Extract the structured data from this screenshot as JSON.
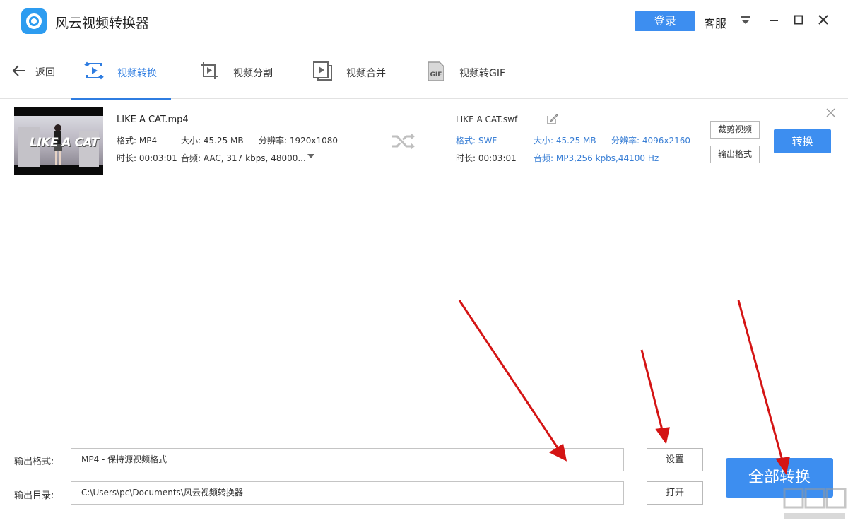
{
  "app": {
    "title": "风云视频转换器",
    "accent_color": "#3d8ef0",
    "login_label": "登录",
    "service_label": "客服"
  },
  "toolbar": {
    "back_label": "返回",
    "tabs": [
      {
        "label": "视频转换",
        "icon": "video-convert-icon",
        "active": true
      },
      {
        "label": "视频分割",
        "icon": "crop-split-icon",
        "active": false
      },
      {
        "label": "视频合并",
        "icon": "merge-icon",
        "active": false
      },
      {
        "label": "视频转GIF",
        "icon": "gif-icon",
        "active": false
      }
    ]
  },
  "file": {
    "thumbnail_text": "LIKE A CAT",
    "source": {
      "name": "LIKE A CAT.mp4",
      "format": "格式: MP4",
      "size": "大小: 45.25 MB",
      "resolution": "分辨率: 1920x1080",
      "duration": "时长: 00:03:01",
      "audio": "音频: AAC, 317 kbps, 48000..."
    },
    "target": {
      "name": "LIKE A CAT.swf",
      "format": "格式: SWF",
      "size": "大小: 45.25 MB",
      "resolution": "分辨率: 4096x2160",
      "duration": "时长: 00:03:01",
      "audio": "音频: MP3,256 kpbs,44100 Hz"
    },
    "crop_label": "裁剪视频",
    "output_format_label": "输出格式",
    "convert_label": "转换"
  },
  "bottom": {
    "format_label": "输出格式:",
    "format_value": "MP4 - 保持源视频格式",
    "settings_label": "设置",
    "dir_label": "输出目录:",
    "dir_value": "C:\\Users\\pc\\Documents\\风云视频转换器",
    "open_label": "打开",
    "all_convert_label": "全部转换"
  },
  "annotation_color": "#d41414"
}
